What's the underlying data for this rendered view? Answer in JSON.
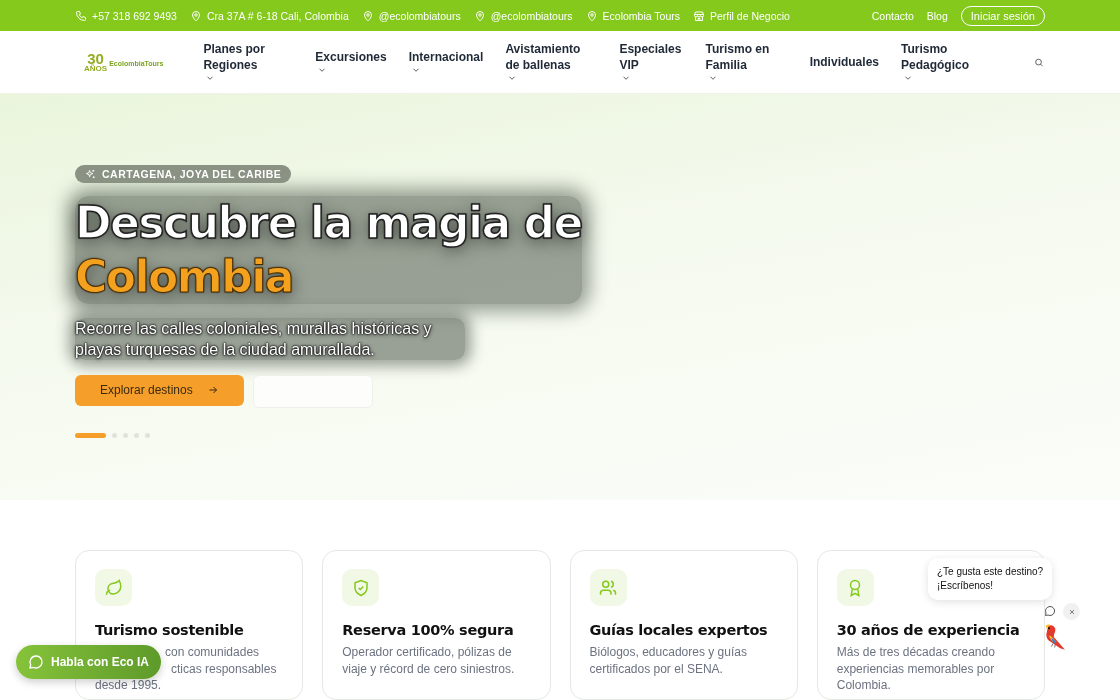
{
  "top_bar": {
    "contacts": [
      {
        "kind": "phone",
        "text": "+57 318 692 9493"
      },
      {
        "kind": "pin",
        "text": "Cra 37A # 6-18 Cali, Colombia"
      },
      {
        "kind": "pin",
        "text": "@ecolombiatours"
      },
      {
        "kind": "pin",
        "text": "@ecolombiatours"
      },
      {
        "kind": "pin",
        "text": "Ecolombia Tours"
      },
      {
        "kind": "store",
        "text": "Perfil de Negocio"
      }
    ],
    "links": [
      "Contacto",
      "Blog"
    ],
    "login_button": "Iniciar sesión"
  },
  "logo": {
    "years": "30",
    "years_label": "AÑOS",
    "brand": "EcolombiaTours"
  },
  "nav": {
    "items": [
      {
        "label": "Planes por Regiones",
        "has_dropdown": true
      },
      {
        "label": "Excursiones",
        "has_dropdown": true
      },
      {
        "label": "Internacional",
        "has_dropdown": true
      },
      {
        "label": "Avistamiento de ballenas",
        "has_dropdown": true
      },
      {
        "label": "Especiales VIP",
        "has_dropdown": true
      },
      {
        "label": "Turismo en Familia",
        "has_dropdown": true
      },
      {
        "label": "Individuales",
        "has_dropdown": false
      },
      {
        "label": "Turismo Pedagógico",
        "has_dropdown": true
      }
    ]
  },
  "hero": {
    "badge": "CARTAGENA, JOYA DEL CARIBE",
    "title": "Descubre la magia de",
    "title_highlight": "Colombia",
    "subtitle": "Recorre las calles coloniales, murallas históricas y playas turquesas de la ciudad amurallada.",
    "primary_button": "Explorar destinos",
    "slides": [
      {
        "selected": true
      },
      {
        "selected": false
      },
      {
        "selected": false
      },
      {
        "selected": false
      },
      {
        "selected": false
      }
    ]
  },
  "features": [
    {
      "kind": "leaf",
      "title": "Turismo sostenible",
      "description_lines": [
        "con comunidades",
        "cticas responsables",
        "desde 1995."
      ]
    },
    {
      "kind": "shield",
      "title": "Reserva 100% segura",
      "description_lines": [
        "Operador certificado, pólizas de",
        "viaje y récord de cero siniestros."
      ]
    },
    {
      "kind": "people",
      "title": "Guías locales expertos",
      "description_lines": [
        "Biólogos, educadores y guías",
        "certificados por el SENA."
      ]
    },
    {
      "kind": "award",
      "title": "30 años de experiencia",
      "description_lines": [
        "Más de tres décadas creando",
        "experiencias memorables por",
        "Colombia."
      ]
    }
  ],
  "chat_button": "Habla con Eco IA",
  "chat_bubble": {
    "lines": [
      "¿Te gusta este destino?",
      "¡Escríbenos!"
    ]
  }
}
